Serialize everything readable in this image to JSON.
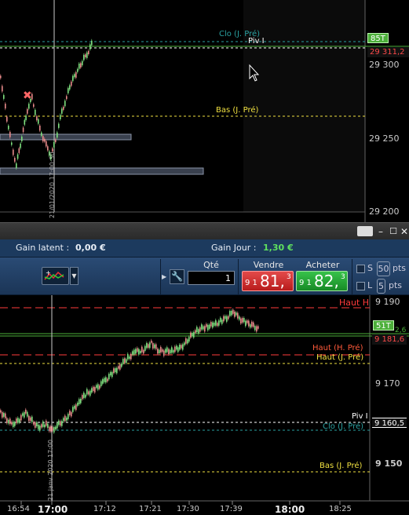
{
  "top_chart": {
    "y_axis_ticks": [
      "29 300",
      "29 250",
      "29 200"
    ],
    "levels": {
      "clo_label": "Clo (J. Pré)",
      "piv_label": "Piv I",
      "bas_label": "Bas (J. Pré)"
    },
    "price_tags": {
      "volume": "85T",
      "last": "29 311,2"
    },
    "vertical_date": "21/01/2020 17:00:30"
  },
  "title_bar": {},
  "gain_bar": {
    "latent_label": "Gain latent :",
    "latent_value": "0,00 €",
    "jour_label": "Gain Jour :",
    "jour_value": "1,30 €"
  },
  "order_panel": {
    "qty_label": "Qté",
    "qty_value": "1",
    "sell_label": "Vendre",
    "buy_label": "Acheter",
    "sell_price_small": "9 1",
    "sell_price_big": "81,",
    "sell_price_sup": "3",
    "buy_price_small": "9 1",
    "buy_price_big": "82,",
    "buy_price_sup": "3",
    "s_label": "S",
    "s_value": "50",
    "l_label": "L",
    "l_value": "5",
    "pts_label": "pts"
  },
  "bottom_chart": {
    "y_axis_ticks": [
      "9 190",
      "9 170",
      "9 150"
    ],
    "levels": {
      "haut_h_label": "Haut H",
      "haut_h_pre_label": "Haut (H. Pré)",
      "haut_j_pre_label": "Haut (J. Pré)",
      "piv_label": "Piv I",
      "clo_label": "Clo (J. Pré)",
      "bas_label": "Bas (J. Pré)"
    },
    "price_tags": {
      "volume": "51T",
      "volume_suffix": "2,6",
      "last": "9 181,6",
      "piv_value": "9 160,5"
    },
    "vertical_date": "21 janv 2020 17:00",
    "time_axis": [
      "16:54",
      "17:00",
      "17:12",
      "17:21",
      "17:30",
      "17:39",
      "18:00",
      "18:25"
    ]
  },
  "colors": {
    "bullish": "#7fe07f",
    "bearish": "#e88a8a",
    "haut_red": "#ff3b3b",
    "yellow": "#f0e040",
    "teal": "#2aa0a0",
    "green_line": "#4caf3a"
  }
}
